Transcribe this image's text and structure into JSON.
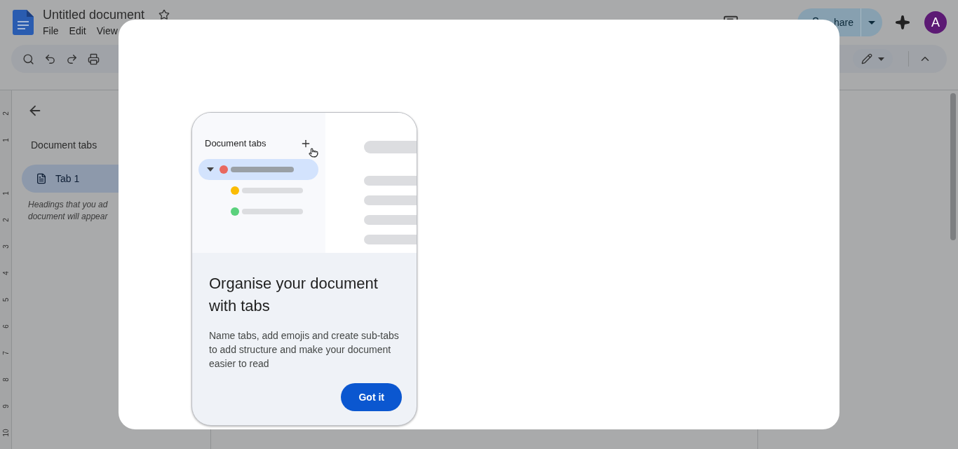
{
  "document": {
    "title": "Untitled document",
    "menu": [
      "File",
      "Edit",
      "View"
    ]
  },
  "header": {
    "share_label": "hare",
    "avatar_letter": "A"
  },
  "sidebar": {
    "title": "Document tabs",
    "tabs": [
      {
        "label": "Tab 1",
        "selected": true
      }
    ],
    "hint_lines": [
      "Headings that you ad",
      "document will appear"
    ]
  },
  "ruler": [
    "2",
    "1",
    "1",
    "2",
    "3",
    "4",
    "5",
    "6",
    "7",
    "8",
    "9",
    "10"
  ],
  "dialog": {
    "illustration": {
      "title": "Document tabs",
      "rows": [
        {
          "color": "#e8685f",
          "selected": true,
          "children": [
            {
              "color": "#fbbc04",
              "selected": false
            },
            {
              "color": "#5bd17d",
              "selected": false
            }
          ]
        }
      ]
    },
    "heading": "Organise your document with tabs",
    "body": "Name tabs, add emojis and create sub-tabs to add structure and make your document easier to read",
    "button": "Got it"
  }
}
